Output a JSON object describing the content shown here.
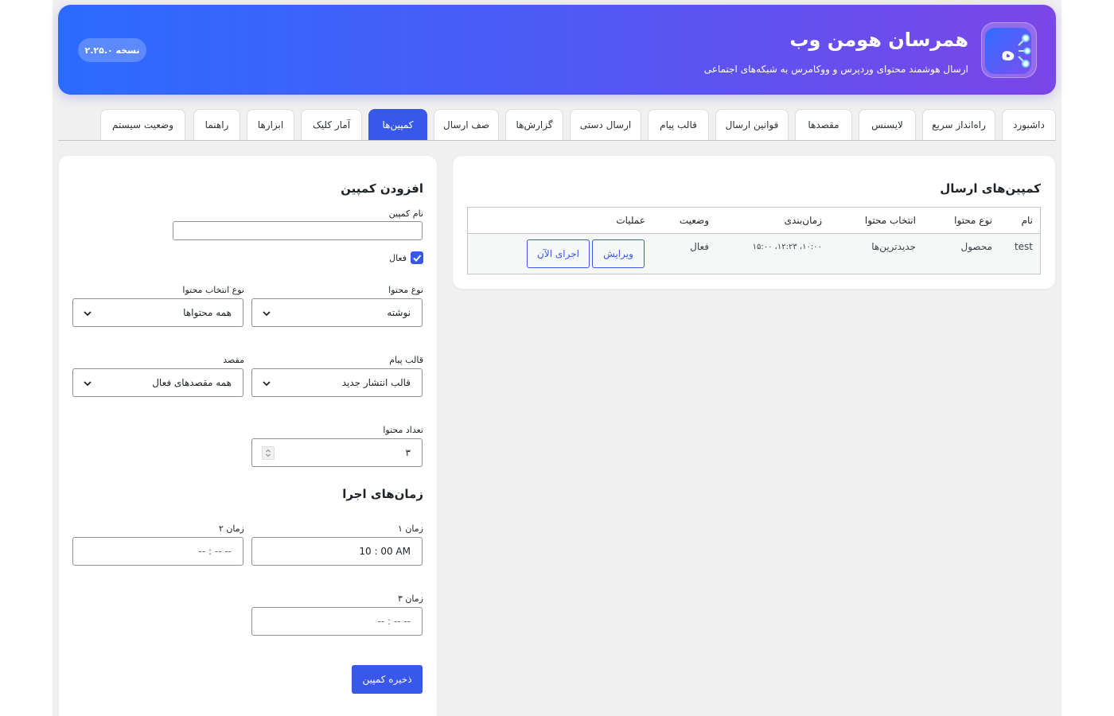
{
  "header": {
    "title": "همرسان هومن وب",
    "subtitle": "ارسال هوشمند محتوای وردپرس و ووکامرس به شبکه‌های اجتماعی",
    "version": "نسخه ۲.۲۵.۰",
    "logo_icon": "plugin-logo-icon"
  },
  "tabs": [
    {
      "label": "داشبورد"
    },
    {
      "label": "راه‌انداز سریع"
    },
    {
      "label": "لایسنس"
    },
    {
      "label": "مقصدها"
    },
    {
      "label": "قوانین ارسال"
    },
    {
      "label": "قالب پیام"
    },
    {
      "label": "ارسال دستی"
    },
    {
      "label": "گزارش‌ها"
    },
    {
      "label": "صف ارسال"
    },
    {
      "label": "کمپین‌ها"
    },
    {
      "label": "آمار کلیک"
    },
    {
      "label": "ابزارها"
    },
    {
      "label": "راهنما"
    },
    {
      "label": "وضعیت سیستم"
    }
  ],
  "active_tab": "کمپین‌ها",
  "campaigns_panel": {
    "title": "کمپین‌های ارسال",
    "columns": [
      "نام",
      "نوع محتوا",
      "انتخاب محتوا",
      "زمان‌بندی",
      "وضعیت",
      "عملیات"
    ],
    "rows": [
      {
        "name": "test",
        "content_type": "محصول",
        "content_selection": "جدیدترین‌ها",
        "schedule": "۱۰:۰۰، ۱۲:۲۳، ۱۵:۰۰",
        "status": "فعال",
        "edit_label": "ویرایش",
        "run_label": "اجرای الآن"
      }
    ]
  },
  "add_campaign": {
    "title": "افزودن کمپین",
    "name_label": "نام کمپین",
    "name_value": "",
    "active_label": "فعال",
    "active_checked": true,
    "content_type_label": "نوع محتوا",
    "content_type_value": "نوشته",
    "selection_type_label": "نوع انتخاب محتوا",
    "selection_type_value": "همه محتواها",
    "template_label": "قالب پیام",
    "template_value": "قالب انتشار جدید",
    "destination_label": "مقصد",
    "destination_value": "همه مقصدهای فعال",
    "count_label": "تعداد محتوا",
    "count_value": "۳",
    "schedule_title": "زمان‌های اجرا",
    "time1_label": "زمان ۱",
    "time1_value": "10 : 00   AM",
    "time2_label": "زمان ۲",
    "time2_value": "-- : --   --",
    "time3_label": "زمان ۳",
    "time3_value": "-- : --   --",
    "save_label": "ذخیره کمپین"
  },
  "colors": {
    "accent": "#3858e9",
    "header_gradient_start": "#2b6bff",
    "header_gradient_end": "#7b45e8"
  }
}
